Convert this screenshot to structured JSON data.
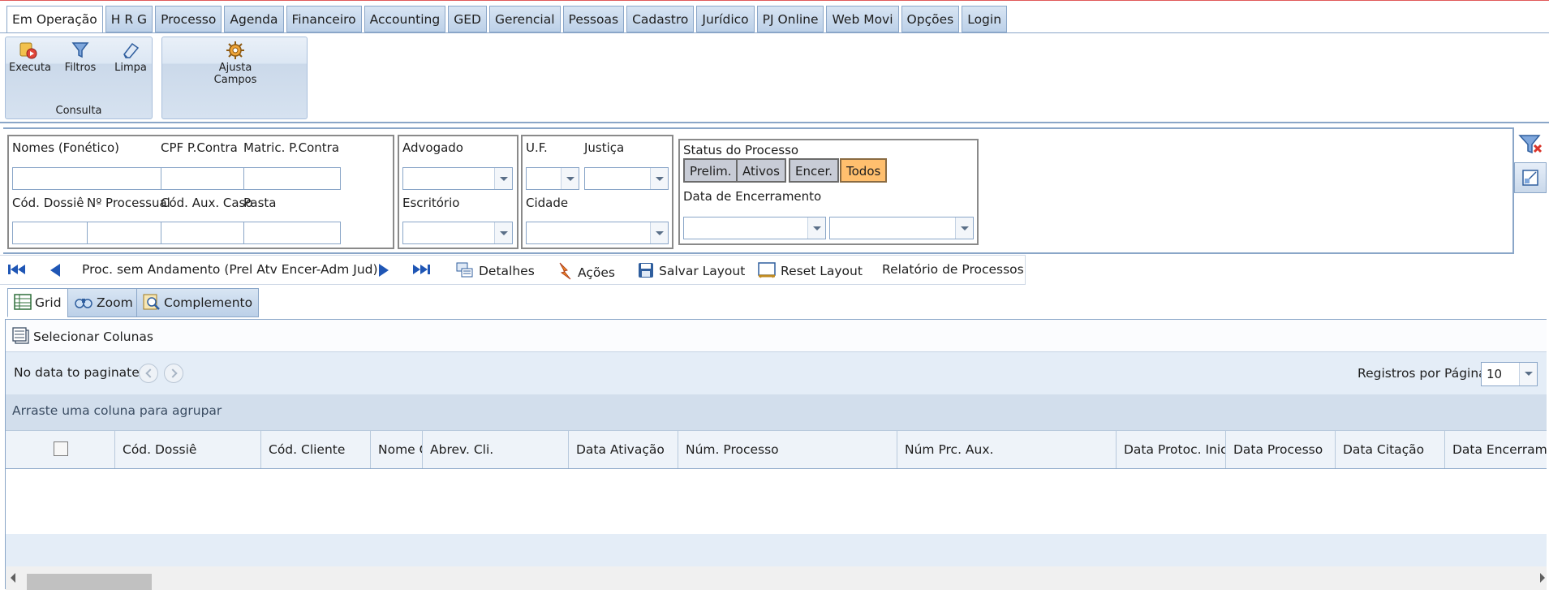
{
  "menu_tabs": [
    "Em Operação",
    "H R G",
    "Processo",
    "Agenda",
    "Financeiro",
    "Accounting",
    "GED",
    "Gerencial",
    "Pessoas",
    "Cadastro",
    "Jurídico",
    "PJ Online",
    "Web Movi",
    "Opções",
    "Login"
  ],
  "ribbon": {
    "consulta": {
      "caption": "Consulta",
      "executa": "Executa",
      "filtros": "Filtros",
      "limpa": "Limpa"
    },
    "ajusta": {
      "line1": "Ajusta",
      "line2": "Campos"
    }
  },
  "filters": {
    "nomes_label": "Nomes (Fonético)",
    "cpf_label": "CPF P.Contra",
    "matric_label": "Matric. P.Contra",
    "cod_dossie_label": "Cód. Dossiê",
    "num_processual_label": "Nº Processual",
    "cod_aux_caso_label": "Cód. Aux. Caso",
    "pasta_label": "Pasta",
    "advogado_label": "Advogado",
    "escritorio_label": "Escritório",
    "uf_label": "U.F.",
    "justica_label": "Justiça",
    "cidade_label": "Cidade",
    "status_title": "Status do Processo",
    "status_options": [
      "Prelim.",
      "Ativos",
      "Encer.",
      "Todos"
    ],
    "status_selected": "Todos",
    "data_encerramento_label": "Data de Encerramento"
  },
  "nav_toolbar": {
    "title": "Proc. sem Andamento (Prel Atv Encer-Adm Jud)",
    "detalhes": "Detalhes",
    "acoes": "Ações",
    "salvar_layout": "Salvar Layout",
    "reset_layout": "Reset Layout",
    "relatorio": "Relatório de Processos"
  },
  "grid_tabs": [
    "Grid",
    "Zoom",
    "Complemento"
  ],
  "grid": {
    "select_columns": "Selecionar Colunas",
    "no_data": "No data to paginate",
    "registros_label": "Registros por Página",
    "registros_value": "10",
    "group_hint": "Arraste uma coluna para agrupar",
    "columns": [
      "Cód. Dossiê",
      "Cód. Cliente",
      "Nome Cliente",
      "Abrev. Cli.",
      "Data Ativação",
      "Núm. Processo",
      "Núm Prc. Aux.",
      "Data Protoc. Inicial",
      "Data Processo",
      "Data Citação",
      "Data Encerramento"
    ]
  },
  "colors": {
    "accent": "#8aa6c8",
    "tab_bg": "#c8d9ec",
    "status_on": "#ffbf6e"
  }
}
